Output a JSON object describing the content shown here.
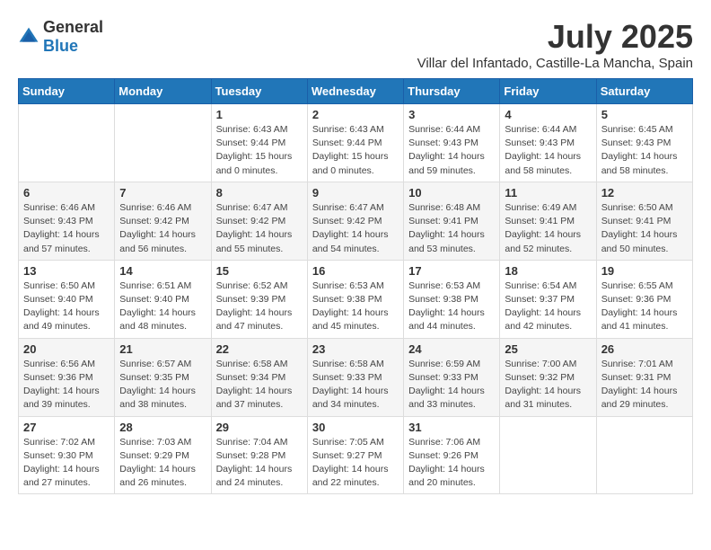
{
  "header": {
    "logo_general": "General",
    "logo_blue": "Blue",
    "title": "July 2025",
    "subtitle": "Villar del Infantado, Castille-La Mancha, Spain"
  },
  "weekdays": [
    "Sunday",
    "Monday",
    "Tuesday",
    "Wednesday",
    "Thursday",
    "Friday",
    "Saturday"
  ],
  "weeks": [
    [
      {
        "day": "",
        "info": ""
      },
      {
        "day": "",
        "info": ""
      },
      {
        "day": "1",
        "info": "Sunrise: 6:43 AM\nSunset: 9:44 PM\nDaylight: 15 hours and 0 minutes."
      },
      {
        "day": "2",
        "info": "Sunrise: 6:43 AM\nSunset: 9:44 PM\nDaylight: 15 hours and 0 minutes."
      },
      {
        "day": "3",
        "info": "Sunrise: 6:44 AM\nSunset: 9:43 PM\nDaylight: 14 hours and 59 minutes."
      },
      {
        "day": "4",
        "info": "Sunrise: 6:44 AM\nSunset: 9:43 PM\nDaylight: 14 hours and 58 minutes."
      },
      {
        "day": "5",
        "info": "Sunrise: 6:45 AM\nSunset: 9:43 PM\nDaylight: 14 hours and 58 minutes."
      }
    ],
    [
      {
        "day": "6",
        "info": "Sunrise: 6:46 AM\nSunset: 9:43 PM\nDaylight: 14 hours and 57 minutes."
      },
      {
        "day": "7",
        "info": "Sunrise: 6:46 AM\nSunset: 9:42 PM\nDaylight: 14 hours and 56 minutes."
      },
      {
        "day": "8",
        "info": "Sunrise: 6:47 AM\nSunset: 9:42 PM\nDaylight: 14 hours and 55 minutes."
      },
      {
        "day": "9",
        "info": "Sunrise: 6:47 AM\nSunset: 9:42 PM\nDaylight: 14 hours and 54 minutes."
      },
      {
        "day": "10",
        "info": "Sunrise: 6:48 AM\nSunset: 9:41 PM\nDaylight: 14 hours and 53 minutes."
      },
      {
        "day": "11",
        "info": "Sunrise: 6:49 AM\nSunset: 9:41 PM\nDaylight: 14 hours and 52 minutes."
      },
      {
        "day": "12",
        "info": "Sunrise: 6:50 AM\nSunset: 9:41 PM\nDaylight: 14 hours and 50 minutes."
      }
    ],
    [
      {
        "day": "13",
        "info": "Sunrise: 6:50 AM\nSunset: 9:40 PM\nDaylight: 14 hours and 49 minutes."
      },
      {
        "day": "14",
        "info": "Sunrise: 6:51 AM\nSunset: 9:40 PM\nDaylight: 14 hours and 48 minutes."
      },
      {
        "day": "15",
        "info": "Sunrise: 6:52 AM\nSunset: 9:39 PM\nDaylight: 14 hours and 47 minutes."
      },
      {
        "day": "16",
        "info": "Sunrise: 6:53 AM\nSunset: 9:38 PM\nDaylight: 14 hours and 45 minutes."
      },
      {
        "day": "17",
        "info": "Sunrise: 6:53 AM\nSunset: 9:38 PM\nDaylight: 14 hours and 44 minutes."
      },
      {
        "day": "18",
        "info": "Sunrise: 6:54 AM\nSunset: 9:37 PM\nDaylight: 14 hours and 42 minutes."
      },
      {
        "day": "19",
        "info": "Sunrise: 6:55 AM\nSunset: 9:36 PM\nDaylight: 14 hours and 41 minutes."
      }
    ],
    [
      {
        "day": "20",
        "info": "Sunrise: 6:56 AM\nSunset: 9:36 PM\nDaylight: 14 hours and 39 minutes."
      },
      {
        "day": "21",
        "info": "Sunrise: 6:57 AM\nSunset: 9:35 PM\nDaylight: 14 hours and 38 minutes."
      },
      {
        "day": "22",
        "info": "Sunrise: 6:58 AM\nSunset: 9:34 PM\nDaylight: 14 hours and 37 minutes."
      },
      {
        "day": "23",
        "info": "Sunrise: 6:58 AM\nSunset: 9:33 PM\nDaylight: 14 hours and 34 minutes."
      },
      {
        "day": "24",
        "info": "Sunrise: 6:59 AM\nSunset: 9:33 PM\nDaylight: 14 hours and 33 minutes."
      },
      {
        "day": "25",
        "info": "Sunrise: 7:00 AM\nSunset: 9:32 PM\nDaylight: 14 hours and 31 minutes."
      },
      {
        "day": "26",
        "info": "Sunrise: 7:01 AM\nSunset: 9:31 PM\nDaylight: 14 hours and 29 minutes."
      }
    ],
    [
      {
        "day": "27",
        "info": "Sunrise: 7:02 AM\nSunset: 9:30 PM\nDaylight: 14 hours and 27 minutes."
      },
      {
        "day": "28",
        "info": "Sunrise: 7:03 AM\nSunset: 9:29 PM\nDaylight: 14 hours and 26 minutes."
      },
      {
        "day": "29",
        "info": "Sunrise: 7:04 AM\nSunset: 9:28 PM\nDaylight: 14 hours and 24 minutes."
      },
      {
        "day": "30",
        "info": "Sunrise: 7:05 AM\nSunset: 9:27 PM\nDaylight: 14 hours and 22 minutes."
      },
      {
        "day": "31",
        "info": "Sunrise: 7:06 AM\nSunset: 9:26 PM\nDaylight: 14 hours and 20 minutes."
      },
      {
        "day": "",
        "info": ""
      },
      {
        "day": "",
        "info": ""
      }
    ]
  ]
}
